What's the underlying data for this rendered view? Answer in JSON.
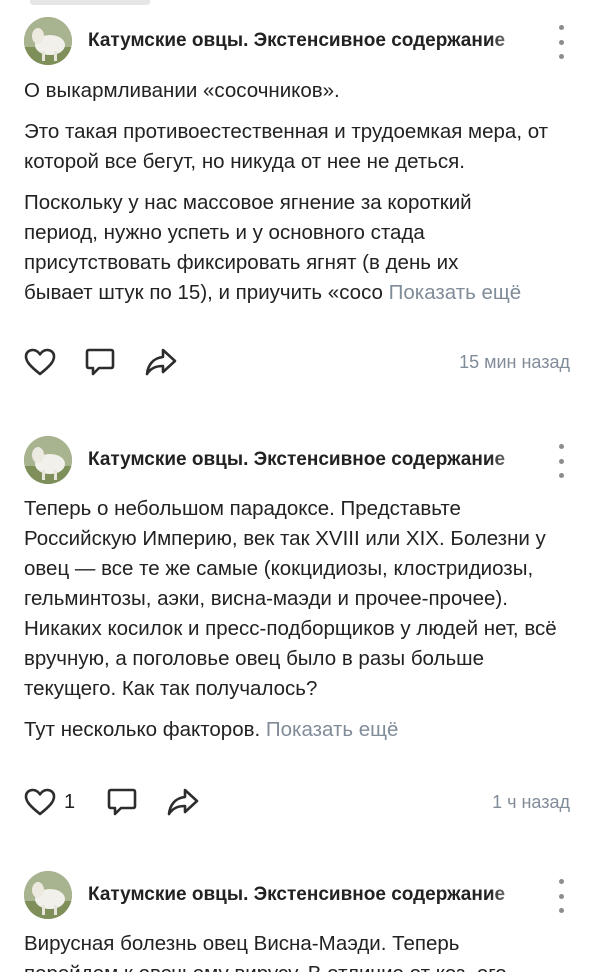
{
  "posts": [
    {
      "author": "Катумские овцы. Экстенсивное содержание",
      "paragraphs": [
        "О выкармливании «сосочников».",
        "Это такая противоестественная и трудоемкая мера, от которой все бегут, но никуда от нее не деться."
      ],
      "truncated_lines": [
        "Поскольку у нас массовое ягнение за короткий",
        "период, нужно успеть и у основного стада",
        "присутствовать фиксировать ягнят (в день их"
      ],
      "last_line": "бывает штук по 15), и приучить «сосо",
      "show_more": "Показать ещё",
      "likes": "",
      "time": "15 мин назад"
    },
    {
      "author": "Катумские овцы. Экстенсивное содержание",
      "paragraphs": [
        "Теперь о небольшом парадоксе. Представьте Российскую Империю, век так XVIII или XIX. Болезни у овец — все те же самые (кокцидиозы, клостридиозы, гельминтозы, аэки, висна-маэди и прочее-прочее). Никаких косилок и пресс-подборщиков у людей нет, всё вручную, а поголовье овец было в разы больше текущего. Как так получалось?"
      ],
      "last_line": "Тут несколько факторов.",
      "show_more": "Показать ещё",
      "likes": "1",
      "time": "1 ч назад"
    },
    {
      "author": "Катумские овцы. Экстенсивное содержание",
      "lines": [
        "Вирусная болезнь овец Висна-Маэди. Теперь",
        "перейдем к овечьему вирусу. В отличие от коз, его"
      ]
    }
  ],
  "icons": {
    "like": "heart-icon",
    "comment": "comment-icon",
    "share": "share-icon",
    "menu": "more-vertical-icon"
  },
  "colors": {
    "text": "#222222",
    "secondary": "#818c99",
    "icon": "#2c2d2e"
  }
}
